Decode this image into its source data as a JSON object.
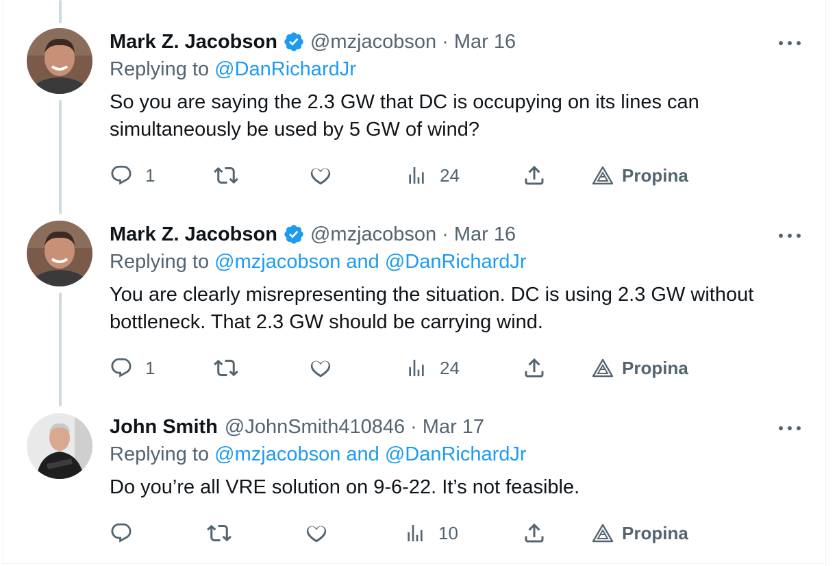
{
  "tweets": [
    {
      "name": "Mark Z. Jacobson",
      "verified": true,
      "handle": "@mzjacobson",
      "date": "Mar 16",
      "replying_prefix": "Replying to",
      "replying_to": "@DanRichardJr",
      "text_lines": [
        "So you are saying the 2.3 GW that DC is occupying on its lines can",
        "simultaneously be used by 5 GW of wind?"
      ],
      "reply_count": "1",
      "retweet_count": "",
      "like_count": "",
      "view_count": "24",
      "tip_label": "Propina"
    },
    {
      "name": "Mark Z. Jacobson",
      "verified": true,
      "handle": "@mzjacobson",
      "date": "Mar 16",
      "replying_prefix": "Replying to",
      "replying_to": "@mzjacobson and @DanRichardJr",
      "text_lines": [
        "You are clearly misrepresenting the situation. DC is using 2.3 GW without",
        "bottleneck. That 2.3 GW should be carrying wind."
      ],
      "reply_count": "1",
      "retweet_count": "",
      "like_count": "",
      "view_count": "24",
      "tip_label": "Propina"
    },
    {
      "name": "John Smith",
      "verified": false,
      "handle": "@JohnSmith410846",
      "date": "Mar 17",
      "replying_prefix": "Replying to",
      "replying_to": "@mzjacobson and @DanRichardJr",
      "text_lines": [
        "Do you’re all VRE solution on 9-6-22. It’s not feasible."
      ],
      "reply_count": "",
      "retweet_count": "",
      "like_count": "",
      "view_count": "10",
      "tip_label": "Propina"
    }
  ],
  "separator": "·",
  "colors": {
    "text": "#0f1419",
    "secondary": "#536471",
    "link": "#1d9bf0",
    "verified": "#1d9bf0",
    "thread_line": "#cfd9de"
  },
  "icons": [
    "reply-icon",
    "retweet-icon",
    "like-icon",
    "views-icon",
    "share-icon",
    "tip-icon",
    "verified-badge-icon",
    "more-icon"
  ]
}
